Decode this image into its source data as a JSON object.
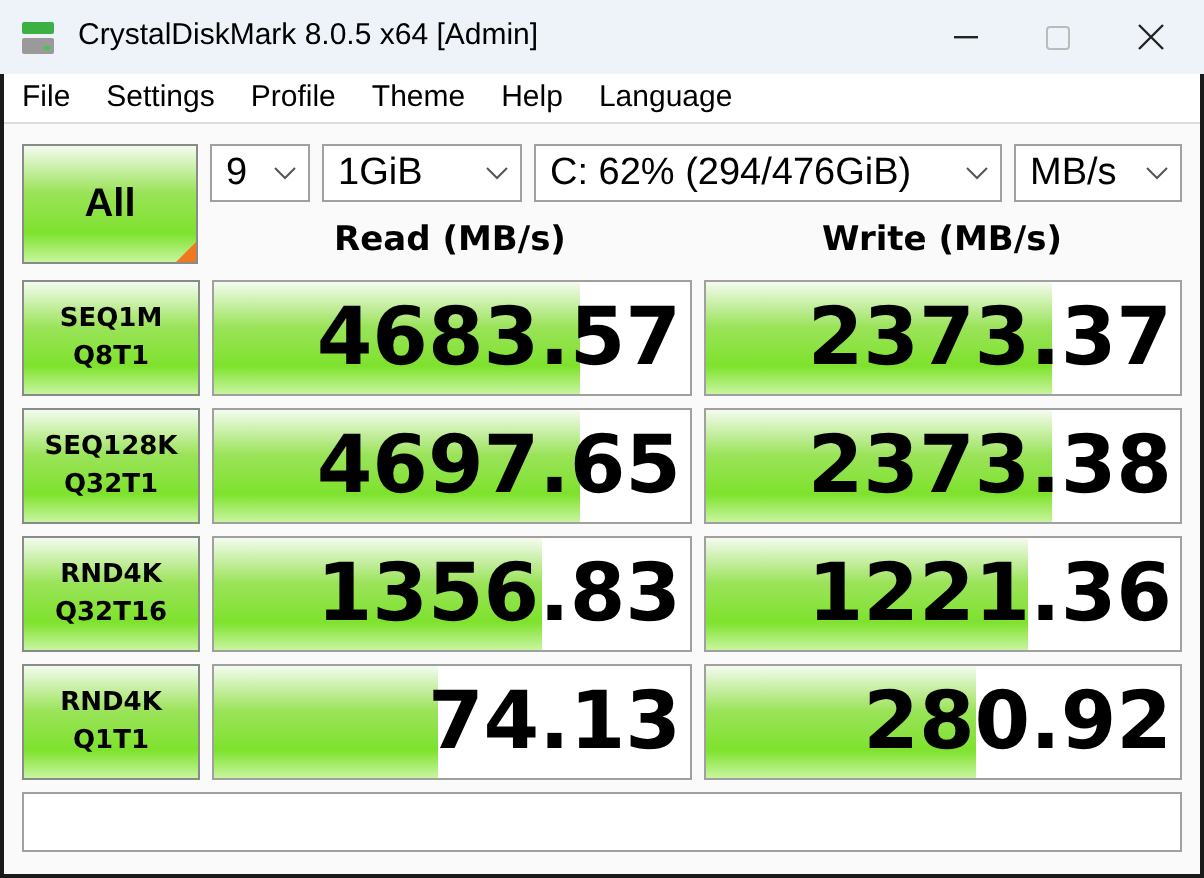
{
  "window": {
    "title": "CrystalDiskMark 8.0.5 x64 [Admin]"
  },
  "menu": [
    "File",
    "Settings",
    "Profile",
    "Theme",
    "Help",
    "Language"
  ],
  "all_button": {
    "label": "All"
  },
  "selectors": [
    {
      "value": "9"
    },
    {
      "value": "1GiB"
    },
    {
      "value": "C: 62% (294/476GiB)"
    },
    {
      "value": "MB/s"
    }
  ],
  "columns": [
    "Read (MB/s)",
    "Write (MB/s)"
  ],
  "tests": [
    {
      "line1": "SEQ1M",
      "line2": "Q8T1",
      "read": {
        "value": "4683.57",
        "level": 0.77
      },
      "write": {
        "value": "2373.37",
        "level": 0.73
      }
    },
    {
      "line1": "SEQ128K",
      "line2": "Q32T1",
      "read": {
        "value": "4697.65",
        "level": 0.77
      },
      "write": {
        "value": "2373.38",
        "level": 0.73
      }
    },
    {
      "line1": "RND4K",
      "line2": "Q32T16",
      "read": {
        "value": "1356.83",
        "level": 0.69
      },
      "write": {
        "value": "1221.36",
        "level": 0.68
      }
    },
    {
      "line1": "RND4K",
      "line2": "Q1T1",
      "read": {
        "value": "74.13",
        "level": 0.47
      },
      "write": {
        "value": "280.92",
        "level": 0.57
      }
    }
  ]
}
